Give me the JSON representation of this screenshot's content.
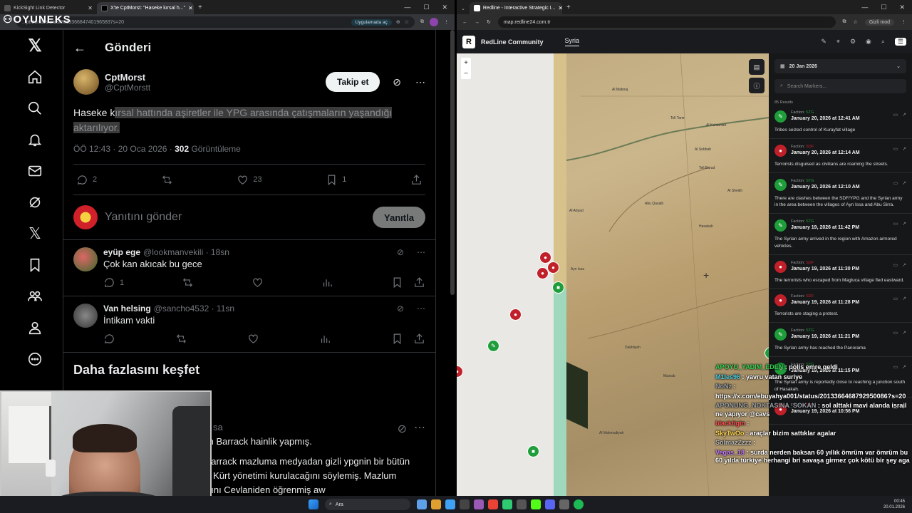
{
  "left_browser": {
    "tabs": [
      {
        "label": "KickSight Link Detector"
      },
      {
        "label": "X'te CptMorst: \"Haseke kırsal h...\""
      }
    ],
    "url": "...ptMorstt/status/2013366847401965837s=20",
    "open_app_chip": "Uygulamada aç"
  },
  "overlay_logo": "OYUNEKS",
  "x_sidebar": {
    "icons": [
      "x-logo-icon",
      "home-icon",
      "search-icon",
      "bell-icon",
      "mail-icon",
      "grok-icon",
      "x-premium-icon",
      "bookmark-icon",
      "communities-icon",
      "profile-icon",
      "more-icon"
    ]
  },
  "post": {
    "header_title": "Gönderi",
    "author_name": "CptMorst",
    "author_handle": "@CptMorstt",
    "follow_label": "Takip et",
    "text_plain": "Haseke k",
    "text_highlight_1": "ırsal hattında aşiretler ile YPG arasında çatışmaların yaşandığı",
    "text_highlight_2": "aktarılıyor.",
    "timestamp": "ÖÖ 12:43 · 20 Oca 2026 ·",
    "views_count": "302",
    "views_label": "Görüntüleme",
    "replies": "2",
    "likes": "23",
    "bookmarks": "1",
    "reply_placeholder": "Yanıtını gönder",
    "reply_button": "Yanıtla"
  },
  "replies": [
    {
      "name": "eyüp ege",
      "handle": "@lookmanvekili · 18sn",
      "text": "Çok kan akıcak bu gece",
      "replies": "1"
    },
    {
      "name": "Van helsing",
      "handle": "@sancho4532 · 11sn",
      "text": "İntikam vakti",
      "replies": ""
    }
  ],
  "discover": {
    "title": "Daha fazlasını keşfet",
    "partial_handle": "sa",
    "line1": "m Barrack hainlik yapmış.",
    "line2": "barrack mazluma medyadan gizli ypgnin bir bütün",
    "line3": "k Kürt yönetimi kurulacağını söylemiş. Mazlum",
    "line4": "ğını Cevlaniden öğrenmiş aw"
  },
  "right_browser": {
    "tab_label": "Redline - Interactive Strategic I...",
    "url": "map.redline24.com.tr",
    "incognito_label": "Gizli mod",
    "app_title": "RedLine Community",
    "region_tab": "Syria",
    "date_filter": "20 Jan 2026",
    "search_placeholder": "Search Markers...",
    "results": "85 Results",
    "faction_prefix": "Faction:",
    "map_labels": [
      "Tell Tamr",
      "Al Sobbah",
      "Tell Barud",
      "Al Kahtaniah",
      "Abu Qasaib",
      "Al Abyad",
      "Ayn Issa",
      "Dakhliyeh",
      "Hasakah",
      "Al Mahmudiyah",
      "Al Mabouj",
      "Al Sheikh",
      "Masrab"
    ],
    "feed": [
      {
        "faction": "STG",
        "color": "#1f9d3a",
        "time": "January 20, 2026 at 12:41 AM",
        "desc": "Tribes seized control of Kurayfat village"
      },
      {
        "faction": "SDF",
        "color": "#c0202a",
        "time": "January 20, 2026 at 12:14 AM",
        "desc": "Terrorists disguised as civilians are roaming the streets."
      },
      {
        "faction": "STG",
        "color": "#1f9d3a",
        "time": "January 20, 2026 at 12:10 AM",
        "desc": "There are clashes between the SDF/YPG and the Syrian army in the area between the villages of Ayn Issa and Abu Sirra."
      },
      {
        "faction": "STG",
        "color": "#1f9d3a",
        "time": "January 19, 2026 at 11:42 PM",
        "desc": "The Syrian army arrived in the region with Amazon armored vehicles."
      },
      {
        "faction": "SDF",
        "color": "#c0202a",
        "time": "January 19, 2026 at 11:30 PM",
        "desc": "The terrorists who escaped from Magluca village fled eastward."
      },
      {
        "faction": "SDF",
        "color": "#c0202a",
        "time": "January 19, 2026 at 11:28 PM",
        "desc": "Terrorists are staging a protest."
      },
      {
        "faction": "STG",
        "color": "#1f9d3a",
        "time": "January 19, 2026 at 11:21 PM",
        "desc": "The Syrian army has reached the Panorama"
      },
      {
        "faction": "STG",
        "color": "#1f9d3a",
        "time": "January 19, 2026 at 11:15 PM",
        "desc": "The Syrian army is reportedly close to reaching a junction south of Hasakah."
      },
      {
        "faction": "SDF",
        "color": "#c0202a",
        "time": "January 19, 2026 at 10:56 PM",
        "desc": ""
      }
    ]
  },
  "chat": [
    {
      "user": "APOYU_YADIM_EDEN",
      "user_color": "#39d353",
      "msg": ": polis emre geldi"
    },
    {
      "user": "M1les96",
      "user_color": "#4dd0e1",
      "msg": ": yavru vatan suriye"
    },
    {
      "user": "NoNz",
      "user_color": "#9aa0a6",
      "msg": ":"
    },
    {
      "user": "",
      "user_color": "#fff",
      "msg": "https://x.com/ebuyahya001/status/2013366468792950086?s=20"
    },
    {
      "user": "APONUNG_NOKTASINA_SOKAN",
      "user_color": "#9aa0a6",
      "msg": ": sol alttaki mavi alanda israil ne yapıyor @cavs"
    },
    {
      "user": "blacktigin",
      "user_color": "#ff4d4d",
      "msg": ":"
    },
    {
      "user": "SkyTwOo",
      "user_color": "#ffd54f",
      "msg": ": araçlar bizim sattıklar agalar"
    },
    {
      "user": "SolmazZzzz",
      "user_color": "#bbb",
      "msg": ":"
    },
    {
      "user": "Vegas_18",
      "user_color": "#c77dff",
      "msg": ": surda nerden baksan 60 yıllık ömrüm var ömrüm bu 60 yılda türkiye herhangi bri savaşa girmez çok kötü bir şey aga"
    }
  ],
  "taskbar": {
    "search": "Ara",
    "clock_time": "00:45",
    "clock_date": "20.01.2026"
  },
  "colors": {
    "x_blue": "#1d9bf0",
    "sdf_red": "#c0202a",
    "stg_green": "#1f9d3a",
    "map_green": "#8fd3b0"
  }
}
